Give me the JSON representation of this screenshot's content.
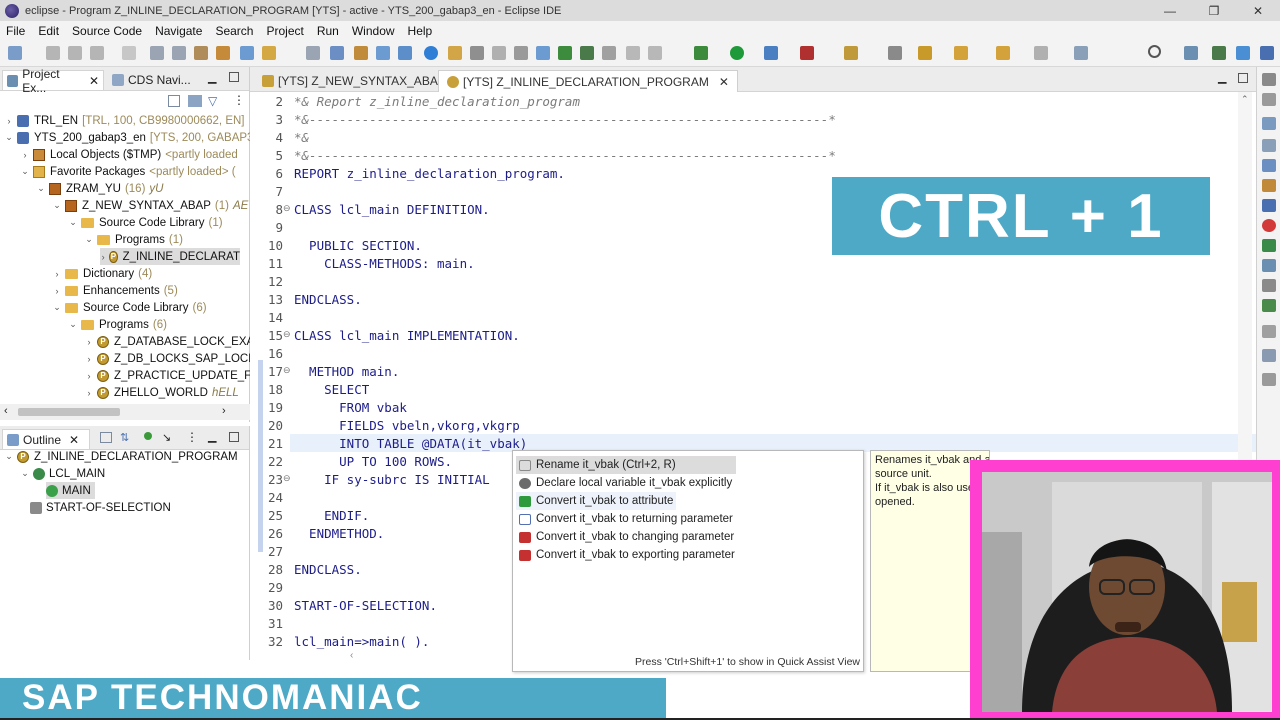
{
  "window": {
    "title": "eclipse - Program Z_INLINE_DECLARATION_PROGRAM [YTS] - active - YTS_200_gabap3_en - Eclipse IDE",
    "min_label": "—",
    "max_label": "❐",
    "close_label": "✕"
  },
  "menu": [
    "File",
    "Edit",
    "Source Code",
    "Navigate",
    "Search",
    "Project",
    "Run",
    "Window",
    "Help"
  ],
  "project_pane": {
    "tabs": [
      "Project Ex...",
      "CDS Navi..."
    ],
    "tree": [
      {
        "label": "TRL_EN",
        "decoration": "[TRL, 100, CB9980000662, EN]"
      },
      {
        "label": "YTS_200_gabap3_en",
        "decoration": "[YTS, 200, GABAP3,"
      },
      {
        "label": "Local Objects ($TMP)",
        "decoration": "<partly loaded"
      },
      {
        "label": "Favorite Packages",
        "decoration": "<partly loaded> ("
      },
      {
        "label": "ZRAM_YU",
        "decoration": "(16)",
        "italic": "yU"
      },
      {
        "label": "Z_NEW_SYNTAX_ABAP",
        "decoration": "(1)",
        "italic": "AE"
      },
      {
        "label": "Source Code Library",
        "decoration": "(1)"
      },
      {
        "label": "Programs",
        "decoration": "(1)"
      },
      {
        "label": "Z_INLINE_DECLARAT",
        "decoration": ""
      },
      {
        "label": "Dictionary",
        "decoration": "(4)"
      },
      {
        "label": "Enhancements",
        "decoration": "(5)"
      },
      {
        "label": "Source Code Library",
        "decoration": "(6)"
      },
      {
        "label": "Programs",
        "decoration": "(6)"
      },
      {
        "label": "Z_DATABASE_LOCK_EXA",
        "decoration": ""
      },
      {
        "label": "Z_DB_LOCKS_SAP_LOCK",
        "decoration": ""
      },
      {
        "label": "Z_PRACTICE_UPDATE_FI",
        "decoration": ""
      },
      {
        "label": "ZHELLO_WORLD",
        "decoration": "",
        "italic": "hELL"
      }
    ]
  },
  "outline_pane": {
    "tab": "Outline",
    "tree": [
      "Z_INLINE_DECLARATION_PROGRAM",
      "LCL_MAIN",
      "MAIN",
      "START-OF-SELECTION"
    ]
  },
  "editor": {
    "tabs": [
      "[YTS] Z_NEW_SYNTAX_ABAP",
      "[YTS] Z_INLINE_DECLARATION_PROGRAM"
    ],
    "lines": [
      {
        "n": "2",
        "text": "*& Report z_inline_declaration_program"
      },
      {
        "n": "3",
        "text": "*&---------------------------------------------------------------------*"
      },
      {
        "n": "4",
        "text": "*&"
      },
      {
        "n": "5",
        "text": "*&---------------------------------------------------------------------*"
      },
      {
        "n": "6",
        "text": "REPORT z_inline_declaration_program."
      },
      {
        "n": "7",
        "text": ""
      },
      {
        "n": "8",
        "text": "CLASS lcl_main DEFINITION."
      },
      {
        "n": "9",
        "text": ""
      },
      {
        "n": "10",
        "text": "  PUBLIC SECTION."
      },
      {
        "n": "11",
        "text": "    CLASS-METHODS: main."
      },
      {
        "n": "12",
        "text": ""
      },
      {
        "n": "13",
        "text": "ENDCLASS."
      },
      {
        "n": "14",
        "text": ""
      },
      {
        "n": "15",
        "text": "CLASS lcl_main IMPLEMENTATION."
      },
      {
        "n": "16",
        "text": ""
      },
      {
        "n": "17",
        "text": "  METHOD main."
      },
      {
        "n": "18",
        "text": "    SELECT"
      },
      {
        "n": "19",
        "text": "      FROM vbak"
      },
      {
        "n": "20",
        "text": "      FIELDS vbeln,vkorg,vkgrp"
      },
      {
        "n": "21",
        "text": "      INTO TABLE @DATA(it_vbak)"
      },
      {
        "n": "22",
        "text": "      UP TO 100 ROWS."
      },
      {
        "n": "23",
        "text": "    IF sy-subrc IS INITIAL"
      },
      {
        "n": "24",
        "text": ""
      },
      {
        "n": "25",
        "text": "    ENDIF."
      },
      {
        "n": "26",
        "text": "  ENDMETHOD."
      },
      {
        "n": "27",
        "text": ""
      },
      {
        "n": "28",
        "text": "ENDCLASS."
      },
      {
        "n": "29",
        "text": ""
      },
      {
        "n": "30",
        "text": "START-OF-SELECTION."
      },
      {
        "n": "31",
        "text": ""
      },
      {
        "n": "32",
        "text": "lcl_main=>main( )."
      }
    ]
  },
  "banner": {
    "text": "CTRL + 1"
  },
  "quick_assist": {
    "items": [
      {
        "label": "Rename it_vbak  (Ctrl+2, R)",
        "icon_color": "#8a8a8a"
      },
      {
        "label": "Declare local variable it_vbak explicitly",
        "icon_color": "#6b6b6b"
      },
      {
        "label": "Convert it_vbak to attribute",
        "icon_color": "#2e9a3e"
      },
      {
        "label": "Convert it_vbak to returning parameter",
        "icon_color": "#5570b0"
      },
      {
        "label": "Convert it_vbak to changing parameter",
        "icon_color": "#c53030"
      },
      {
        "label": "Convert it_vbak to exporting parameter",
        "icon_color": "#c53030"
      }
    ],
    "footer": "Press 'Ctrl+Shift+1' to show in Quick Assist View"
  },
  "info": {
    "lines": [
      "Renames it_vbak and adjusts all occurrences of it_vbak in the current",
      "source unit.",
      "If it_vbak is also used",
      "opened."
    ]
  },
  "brand": {
    "text": "SAP TECHNOMANIAC"
  },
  "colors": {
    "accent": "#4ea9c6",
    "webcam_border": "#ff3fd0"
  }
}
